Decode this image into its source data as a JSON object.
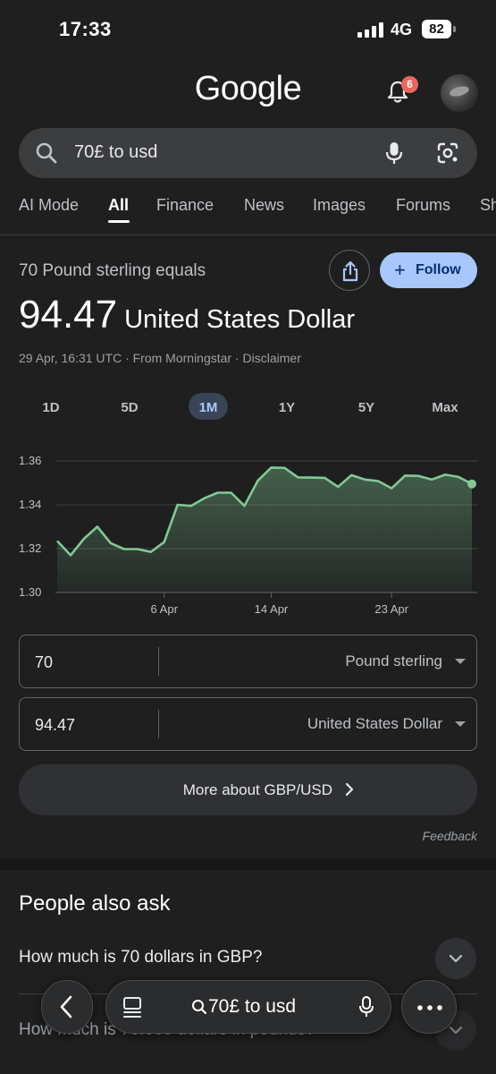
{
  "status_bar": {
    "time": "17:33",
    "network": "4G",
    "battery": "82"
  },
  "header": {
    "logo": "Google",
    "notification_count": "6"
  },
  "search": {
    "query": "70£ to usd"
  },
  "tabs": [
    {
      "label": "AI Mode"
    },
    {
      "label": "All",
      "active": true
    },
    {
      "label": "Finance"
    },
    {
      "label": "News"
    },
    {
      "label": "Images"
    },
    {
      "label": "Forums"
    },
    {
      "label": "Sh"
    }
  ],
  "conversion": {
    "equals_label": "70 Pound sterling equals",
    "follow_label": "Follow",
    "result_value": "94.47",
    "result_currency": "United States Dollar",
    "source": "29 Apr, 16:31 UTC · From Morningstar · Disclaimer"
  },
  "ranges": [
    {
      "label": "1D"
    },
    {
      "label": "5D"
    },
    {
      "label": "1M",
      "selected": true
    },
    {
      "label": "1Y"
    },
    {
      "label": "5Y"
    },
    {
      "label": "Max"
    }
  ],
  "chart_data": {
    "type": "area",
    "title": "",
    "xlabel": "",
    "ylabel": "",
    "y_ticks": [
      "1.36",
      "1.34",
      "1.32",
      "1.30"
    ],
    "ylim": [
      1.3,
      1.36
    ],
    "x_ticks": [
      "6 Apr",
      "14 Apr",
      "23 Apr"
    ],
    "grid": true,
    "line_color": "#81c995",
    "series": [
      {
        "x": [
          "29 Mar",
          "30 Mar",
          "31 Mar",
          "1 Apr",
          "2 Apr",
          "3 Apr",
          "4 Apr",
          "5 Apr",
          "6 Apr",
          "7 Apr",
          "8 Apr",
          "9 Apr",
          "10 Apr",
          "11 Apr",
          "12 Apr",
          "13 Apr",
          "14 Apr",
          "15 Apr",
          "16 Apr",
          "17 Apr",
          "18 Apr",
          "19 Apr",
          "20 Apr",
          "21 Apr",
          "22 Apr",
          "23 Apr",
          "24 Apr",
          "25 Apr",
          "26 Apr",
          "27 Apr",
          "28 Apr",
          "29 Apr"
        ],
        "values": [
          1.3235,
          1.317,
          1.3245,
          1.33,
          1.3225,
          1.3198,
          1.3198,
          1.3185,
          1.323,
          1.34,
          1.3395,
          1.343,
          1.3455,
          1.3455,
          1.3395,
          1.351,
          1.357,
          1.3568,
          1.3525,
          1.3524,
          1.3523,
          1.3482,
          1.3535,
          1.3515,
          1.3508,
          1.3475,
          1.3533,
          1.3532,
          1.3515,
          1.3537,
          1.3527,
          1.3495
        ]
      }
    ]
  },
  "converter": {
    "from_amount": "70",
    "from_currency": "Pound sterling",
    "to_amount": "94.47",
    "to_currency": "United States Dollar"
  },
  "more_button": "More about GBP/USD",
  "feedback": "Feedback",
  "people_also_ask": {
    "title": "People also ask",
    "questions": [
      "How much is 70 dollars in GBP?",
      "How much is 70.000 dollars in pounds?"
    ]
  },
  "bottom_bar": {
    "query": "70£ to usd"
  }
}
